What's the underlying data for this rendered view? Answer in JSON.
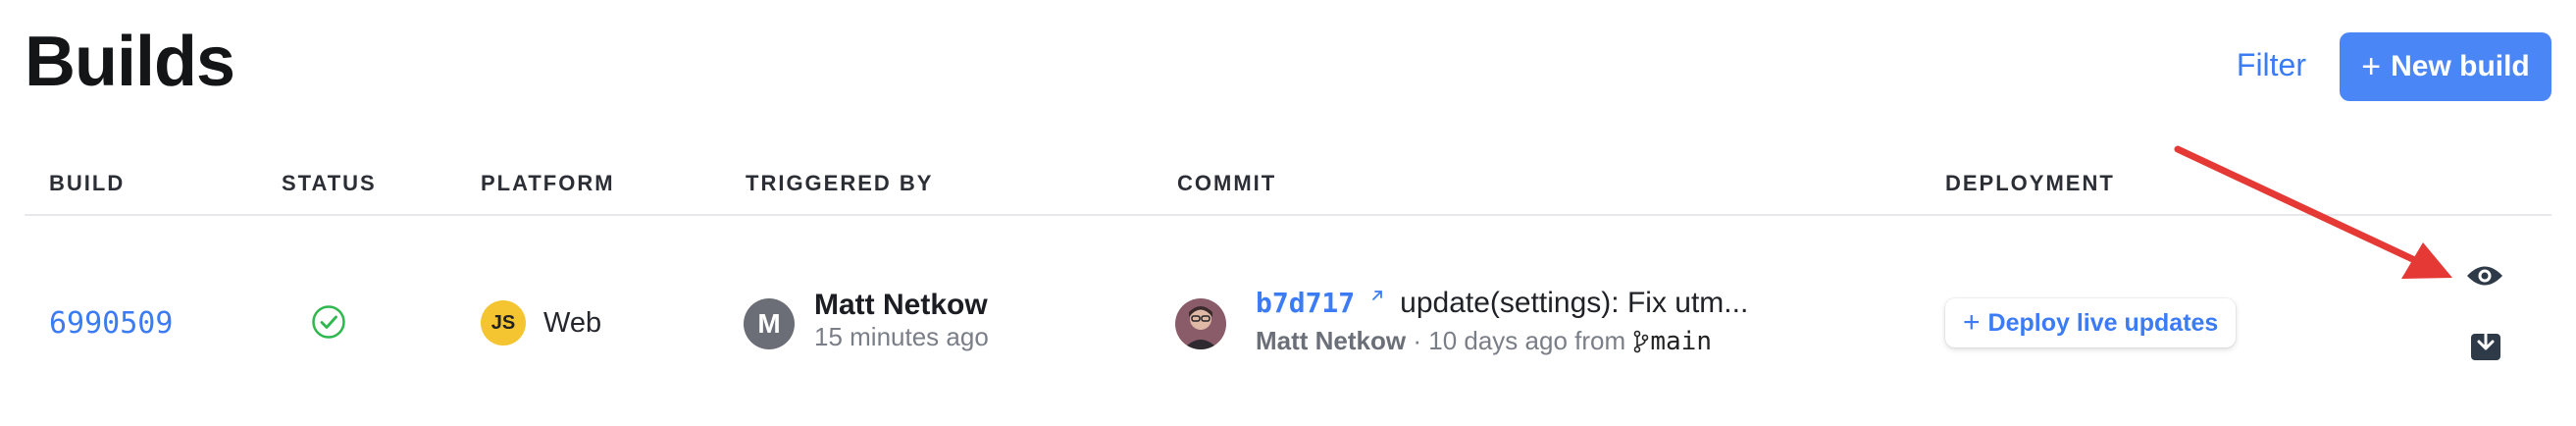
{
  "page": {
    "title": "Builds"
  },
  "toolbar": {
    "filter_label": "Filter",
    "new_build_label": "New build",
    "new_build_plus": "+"
  },
  "table": {
    "columns": [
      "BUILD",
      "STATUS",
      "PLATFORM",
      "TRIGGERED BY",
      "COMMIT",
      "DEPLOYMENT"
    ],
    "rows": [
      {
        "build_id": "6990509",
        "status": "success",
        "platform_badge": "JS",
        "platform": "Web",
        "triggered_by": {
          "initial": "M",
          "name": "Matt Netkow",
          "time": "15 minutes ago"
        },
        "commit": {
          "hash": "b7d717",
          "message": "update(settings): Fix utm...",
          "author": "Matt Netkow",
          "meta": " · 10 days ago from ",
          "branch": "main"
        },
        "deployment": {
          "plus": "+",
          "label": "Deploy live updates"
        },
        "actions": [
          "eye-icon",
          "download-icon"
        ]
      }
    ]
  },
  "colors": {
    "accent": "#3b7cf5",
    "button": "#4b86f7",
    "success": "#2fb84e",
    "annotation_arrow": "#e53935"
  }
}
